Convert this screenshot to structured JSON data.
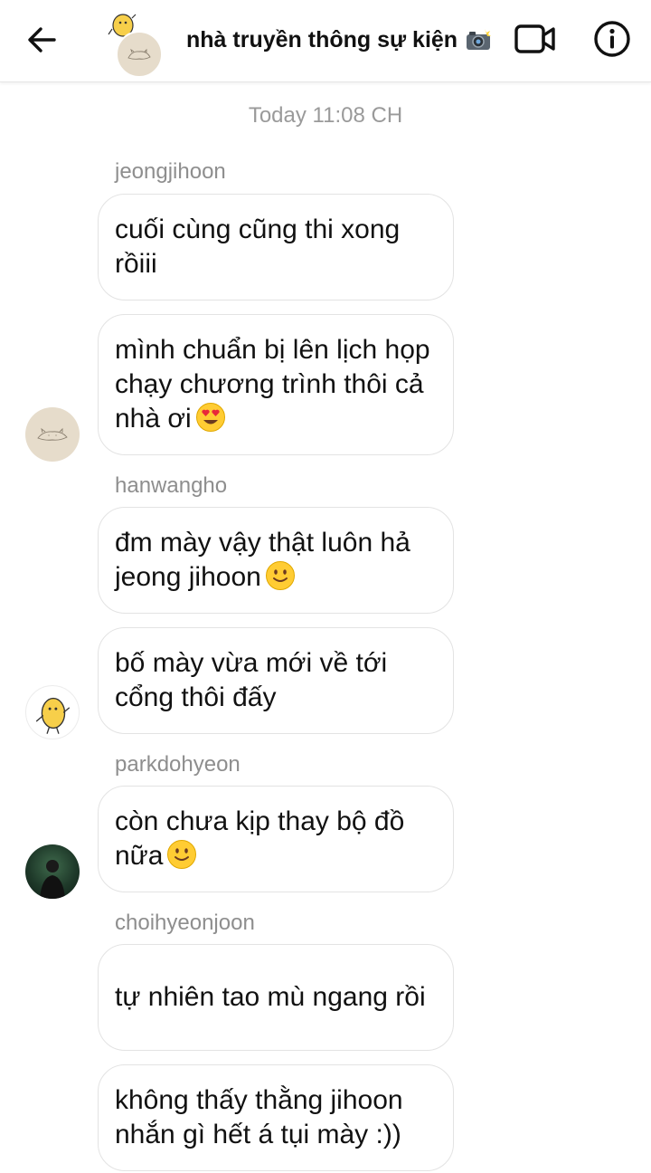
{
  "header": {
    "title": "nhà truyền thông sự kiện",
    "title_emoji": "camera-flash-icon",
    "back_icon": "back-arrow-icon",
    "video_icon": "video-call-icon",
    "info_icon": "info-icon"
  },
  "conversation": {
    "timestamp": "Today 11:08 CH",
    "groups": [
      {
        "sender": "jeongjihoon",
        "avatar": "sleeping-cat-drawing-avatar",
        "messages": [
          "cuối cùng cũng thi xong rồiii",
          "mình chuẩn bị lên lịch họp chạy chương trình thôi cả nhà ơi"
        ],
        "emoji": "heart-eyes-emoji"
      },
      {
        "sender": "hanwangho",
        "avatar": "yellow-potato-avatar",
        "messages": [
          "đm mày vậy thật luôn hả jeong jihoon",
          "bố mày vừa mới về tới cổng thôi đấy"
        ],
        "emoji": "slight-smile-emoji"
      },
      {
        "sender": "parkdohyeon",
        "avatar": "dark-photo-avatar",
        "messages": [
          "còn chưa kịp thay bộ đồ nữa"
        ],
        "emoji": "slight-smile-emoji"
      },
      {
        "sender": "choihyeonjoon",
        "avatar": "none",
        "messages": [
          "tự nhiên tao mù ngang rồi",
          "không thấy thằng jihoon nhắn gì hết á tụi mày :))"
        ]
      }
    ]
  },
  "colors": {
    "bubble_border": "#e3e3e3",
    "meta_text": "#8e8e8e",
    "message_text": "#111111",
    "cat_avatar_bg": "#e6dccb",
    "emoji_yellow": "#ffcc33",
    "heart_red": "#e8283a"
  }
}
